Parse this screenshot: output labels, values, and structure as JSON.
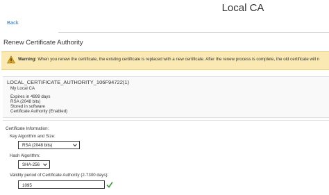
{
  "header": {
    "title": "Local CA",
    "back_label": "Back"
  },
  "section": {
    "title": "Renew Certificate Authority"
  },
  "warning": {
    "label": "Warning:",
    "message": "When you renew the certificate, the existing certificate is replaced with a new certificate. After the renew process is complete, the old certificate will n"
  },
  "ca": {
    "name": "LOCAL_CERTIFICATE_AUTHORITY_106F94722(1)",
    "subtitle": "My Local CA",
    "details": [
      "Expires in 4999 days",
      "RSA (2048 bits)",
      "Stored in software",
      "Certificate Authority (Enabled)"
    ]
  },
  "form": {
    "heading": "Certificate Information:",
    "key_algorithm": {
      "label": "Key Algorithm and Size:",
      "value": "RSA (2048 bits)"
    },
    "hash_algorithm": {
      "label": "Hash Algorithm:",
      "value": "SHA-256"
    },
    "validity": {
      "label": "Validity period of Certificate Authority (2-7300 days):",
      "value": "1095"
    }
  },
  "colors": {
    "link": "#1a73c8",
    "warning_bg": "#fbe9b4",
    "warning_icon": "#e6a817",
    "valid_check": "#3a9a3a"
  },
  "icons": {
    "warning": "warning-triangle-icon",
    "valid": "checkmark-icon",
    "dropdown": "chevron-down-icon"
  }
}
